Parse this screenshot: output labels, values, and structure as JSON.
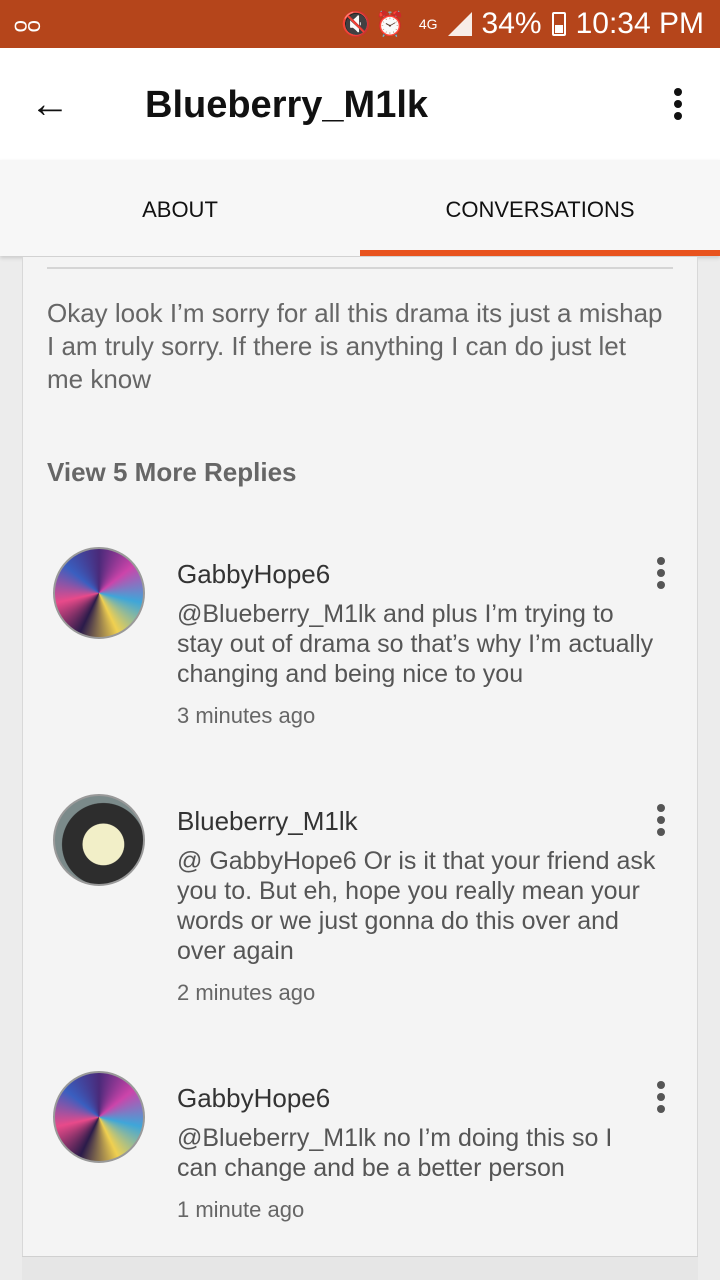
{
  "status_bar": {
    "voicemail_icon": "voicemail-icon",
    "icons": "mute-icon alarm-icon",
    "network": "4G",
    "battery": "34%",
    "time": "10:34 PM"
  },
  "header": {
    "title": "Blueberry_M1lk",
    "back_icon": "arrow-left-icon",
    "back_glyph": "←",
    "menu_icon": "more-vert-icon"
  },
  "tabs": [
    {
      "label": "ABOUT",
      "active": false
    },
    {
      "label": "CONVERSATIONS",
      "active": true
    }
  ],
  "thread": {
    "main_comment": "Okay look I’m sorry for all this drama its just a mishap I am truly sorry. If there is anything I can do just let me know",
    "view_more_label": "View 5 More Replies",
    "replies": [
      {
        "author": "GabbyHope6",
        "text": "@Blueberry_M1lk and plus I’m trying to stay out of drama so that’s why I’m actually changing and being nice to you",
        "time": "3 minutes ago"
      },
      {
        "author": "Blueberry_M1lk",
        "text": "@ GabbyHope6  Or is it that your friend ask you to. But eh, hope you really mean your words or we just gonna do this over and over again",
        "time": "2 minutes ago"
      },
      {
        "author": "GabbyHope6",
        "text": "@Blueberry_M1lk no I’m doing this so I can change and be a better person",
        "time": "1 minute ago"
      }
    ]
  },
  "colors": {
    "status_bar": "#b5451b",
    "accent": "#e8531e"
  }
}
